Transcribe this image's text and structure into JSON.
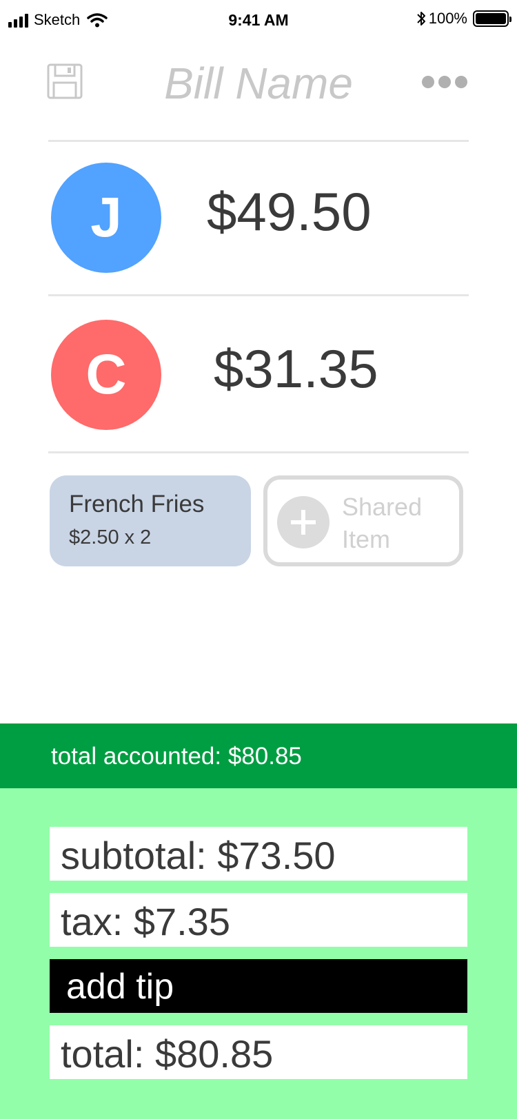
{
  "status_bar": {
    "carrier": "Sketch",
    "time": "9:41 AM",
    "battery": "100%"
  },
  "header": {
    "bill_name_placeholder": "Bill Name"
  },
  "people": [
    {
      "initial": "J",
      "amount": "$49.50",
      "color": "#52a2ff"
    },
    {
      "initial": "C",
      "amount": "$31.35",
      "color": "#ff6a6a"
    }
  ],
  "items": [
    {
      "name": "French Fries",
      "price": "$2.50 x 2"
    }
  ],
  "shared_item_label": "Shared Item",
  "total_accounted": "total accounted: $80.85",
  "summary": {
    "subtotal": "subtotal: $73.50",
    "tax": "tax: $7.35",
    "add_tip": "add tip",
    "total": "total: $80.85"
  },
  "colors": {
    "accounted_bar": "#009e42",
    "summary_bg": "#92fea9",
    "item_card": "#c9d5e5"
  }
}
